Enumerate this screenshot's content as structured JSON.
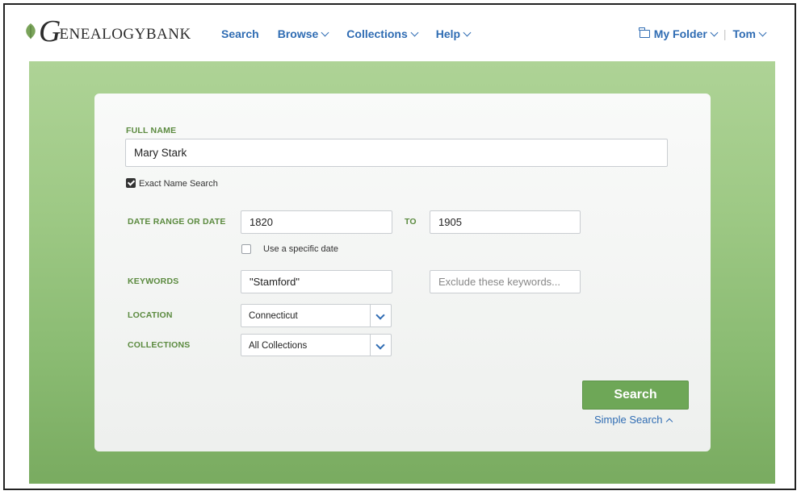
{
  "logo": {
    "initial": "G",
    "rest": "ENEALOGYBANK"
  },
  "nav": {
    "search": "Search",
    "browse": "Browse",
    "collections": "Collections",
    "help": "Help"
  },
  "user_nav": {
    "folder": "My Folder",
    "user": "Tom"
  },
  "form": {
    "full_name_label": "FULL NAME",
    "full_name_value": "Mary Stark",
    "exact_name_label": "Exact Name Search",
    "exact_name_checked": true,
    "date_range_label": "DATE RANGE OR DATE",
    "date_from": "1820",
    "to_label": "TO",
    "date_to": "1905",
    "specific_date_label": "Use a specific date",
    "specific_date_checked": false,
    "keywords_label": "KEYWORDS",
    "keywords_value": "\"Stamford\"",
    "exclude_placeholder": "Exclude these keywords...",
    "location_label": "LOCATION",
    "location_value": "Connecticut",
    "collections_label": "COLLECTIONS",
    "collections_value": "All Collections",
    "search_button": "Search",
    "simple_search_link": "Simple Search"
  },
  "colors": {
    "accent": "#2f6cb3",
    "green": "#6ea757",
    "label_green": "#5b8a3f"
  }
}
